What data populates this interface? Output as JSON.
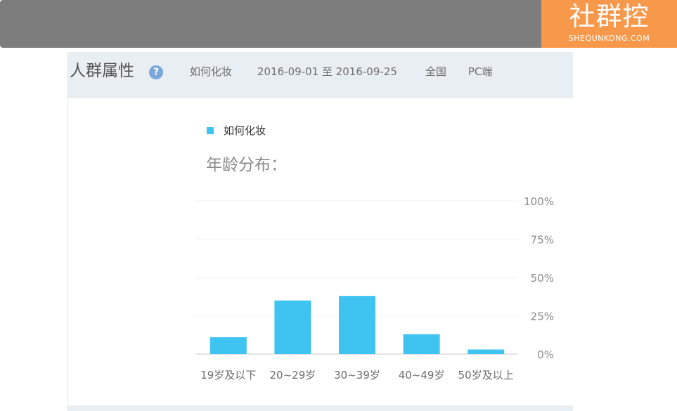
{
  "brand": {
    "name": "社群控",
    "domain": "SHEQUNKONG.COM"
  },
  "header": {
    "title": "人群属性",
    "help_icon": "question-icon",
    "keyword": "如何化妆",
    "date_range": "2016-09-01 至 2016-09-25",
    "region": "全国",
    "platform": "PC端"
  },
  "colors": {
    "topbar": "#7d7d7d",
    "logo_bg": "#f7984a",
    "series": "#3fc3f1",
    "header_bg": "#e9eef3"
  },
  "chart_data": {
    "type": "bar",
    "title": "年龄分布：",
    "legend": [
      "如何化妆"
    ],
    "legend_position": "top-left",
    "categories": [
      "19岁及以下",
      "20~29岁",
      "30~39岁",
      "40~49岁",
      "50岁及以上"
    ],
    "series": [
      {
        "name": "如何化妆",
        "values": [
          11,
          35,
          38,
          13,
          3
        ]
      }
    ],
    "ylim": [
      0,
      100
    ],
    "yticks": [
      0,
      25,
      50,
      75,
      100
    ],
    "ytick_labels": [
      "0%",
      "25%",
      "50%",
      "75%",
      "100%"
    ],
    "y_axis_position": "right",
    "grid": true
  }
}
